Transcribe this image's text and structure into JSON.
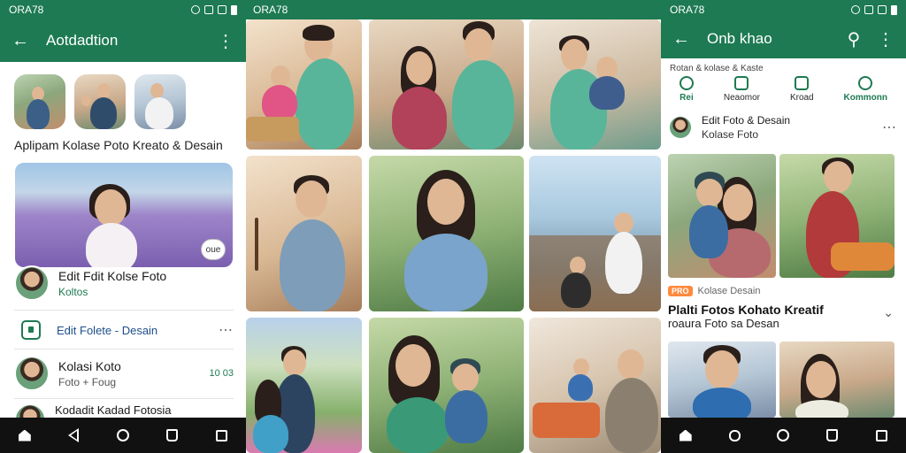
{
  "left": {
    "status_time": "ORA78",
    "app_title": "Aotdadtion",
    "heading": "Aplipam Kolase  Poto Kreato & Desain",
    "hero_badge": "oue",
    "rows": [
      {
        "title": "Edit Fdit Kolse Foto",
        "sub": "Koltos"
      },
      {
        "title": "Edit Folete - Desain",
        "sub": ""
      },
      {
        "title": "Kolasi Koto",
        "sub": "Foto + Foug",
        "meta": "10 03"
      },
      {
        "title": "Kodadit Kadad Fotosia",
        "sub": ""
      }
    ]
  },
  "middle": {
    "status_time": "ORA78"
  },
  "right": {
    "status_time": "ORA78",
    "app_title": "Onb khao",
    "section_label": "Rotan & kolase & Kaste",
    "actions": [
      {
        "label": "Rei",
        "icon": "copy-icon"
      },
      {
        "label": "Neaomor",
        "icon": "image-icon"
      },
      {
        "label": "Kroad",
        "icon": "edit-icon"
      },
      {
        "label": "Kommonn",
        "icon": "people-icon"
      }
    ],
    "post_title": "Edit Foto & Desain",
    "post_sub": "Kolase Foto",
    "tag_label": "Kolase Desain",
    "tag_pill": "PRO",
    "big_title": "Plalti Fotos Kohato Kreatif",
    "big_sub": "roaura Foto sa Desan"
  }
}
